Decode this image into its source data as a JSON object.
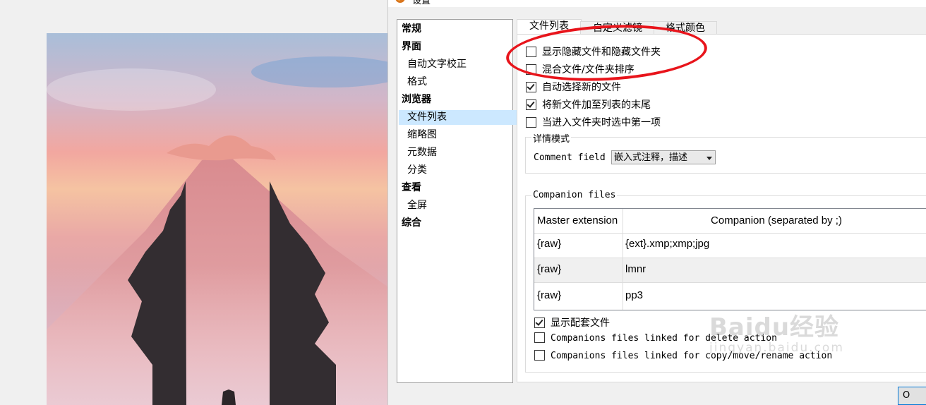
{
  "window": {
    "title": "设置"
  },
  "tree": {
    "items": [
      {
        "label": "常规",
        "level": "top"
      },
      {
        "label": "界面",
        "level": "top"
      },
      {
        "label": "自动文字校正",
        "level": "sub"
      },
      {
        "label": "格式",
        "level": "sub"
      },
      {
        "label": "浏览器",
        "level": "top"
      },
      {
        "label": "文件列表",
        "level": "sub",
        "selected": true
      },
      {
        "label": "缩略图",
        "level": "sub"
      },
      {
        "label": "元数据",
        "level": "sub"
      },
      {
        "label": "分类",
        "level": "sub"
      },
      {
        "label": "查看",
        "level": "top"
      },
      {
        "label": "全屏",
        "level": "sub"
      },
      {
        "label": "综合",
        "level": "top"
      }
    ]
  },
  "tabs": [
    {
      "label": "文件列表",
      "active": true
    },
    {
      "label": "自定义滤镜",
      "active": false
    },
    {
      "label": "格式颜色",
      "active": false
    }
  ],
  "options": [
    {
      "label": "显示隐藏文件和隐藏文件夹",
      "checked": false
    },
    {
      "label": "混合文件/文件夹排序",
      "checked": false
    },
    {
      "label": "自动选择新的文件",
      "checked": true
    },
    {
      "label": "将新文件加至列表的末尾",
      "checked": true
    },
    {
      "label": "当进入文件夹时选中第一项",
      "checked": false
    }
  ],
  "detail_mode": {
    "group_label": "详情模式",
    "comment_field_label": "Comment field",
    "comment_field_value": "嵌入式注释，描述"
  },
  "companion": {
    "group_label": "Companion files",
    "columns": [
      "Master extension",
      "Companion (separated by ;)"
    ],
    "rows": [
      [
        "{raw}",
        "{ext}.xmp;xmp;jpg"
      ],
      [
        "{raw}",
        "lmnr"
      ],
      [
        "{raw}",
        "pp3"
      ]
    ],
    "options": [
      {
        "label": "显示配套文件",
        "checked": true
      },
      {
        "label": "Companions files linked for delete action",
        "checked": false
      },
      {
        "label": "Companions files linked for copy/move/rename action",
        "checked": false
      }
    ]
  },
  "buttons": {
    "ok_label": "O"
  },
  "watermark": {
    "brand": "Baidu经验",
    "url": "jingyan.baidu.com"
  },
  "colors": {
    "annotation": "#e8141b",
    "selection": "#cce8ff"
  }
}
